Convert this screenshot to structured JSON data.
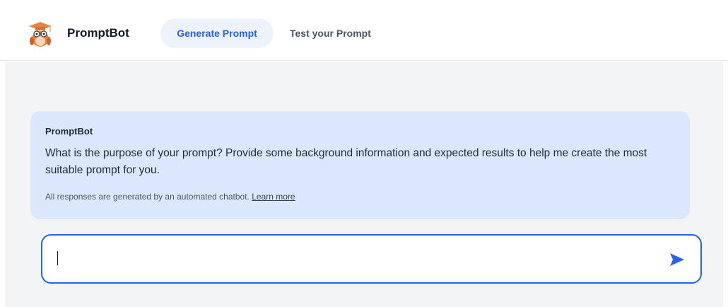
{
  "header": {
    "app_name": "PromptBot",
    "logo_icon": "owl-graduation-cap-logo",
    "tabs": [
      {
        "label": "Generate Prompt",
        "active": true
      },
      {
        "label": "Test your Prompt",
        "active": false
      }
    ]
  },
  "chat": {
    "message": {
      "sender": "PromptBot",
      "text": "What is the purpose of your prompt? Provide some background information and expected results to help me create the most suitable prompt for you.",
      "disclaimer": "All responses are generated by an automated chatbot.",
      "learn_more": "Learn more"
    }
  },
  "composer": {
    "value": "",
    "placeholder": "",
    "send_icon": "send-arrow-icon"
  },
  "colors": {
    "accent": "#2563eb",
    "bubble_bg": "#dbe7fd",
    "main_bg": "#f3f4f6",
    "active_tab_bg": "#eef2fb"
  }
}
